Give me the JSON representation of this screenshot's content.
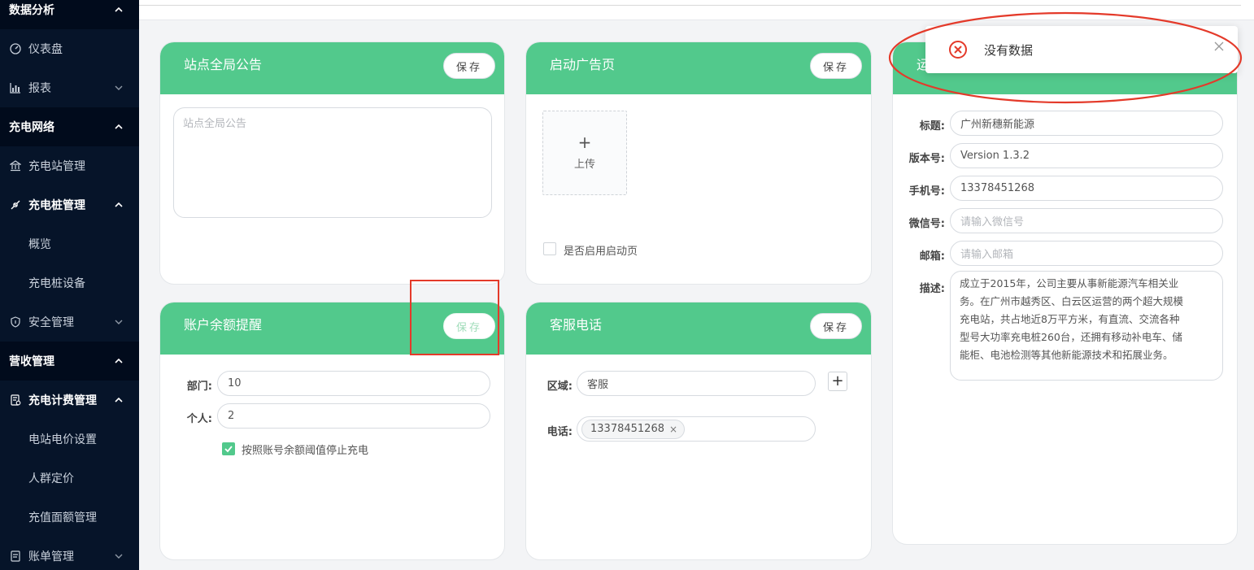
{
  "sidebar": {
    "items": [
      {
        "label": "数据分析",
        "kind": "group",
        "caret": "up"
      },
      {
        "label": "仪表盘",
        "kind": "item",
        "icon": "dashboard-icon"
      },
      {
        "label": "报表",
        "kind": "item",
        "icon": "chart-icon",
        "caret": "down"
      },
      {
        "label": "充电网络",
        "kind": "group",
        "caret": "up"
      },
      {
        "label": "充电站管理",
        "kind": "item",
        "icon": "bank-icon"
      },
      {
        "label": "充电桩管理",
        "kind": "item",
        "icon": "plug-icon",
        "caret": "up",
        "expanded": true
      },
      {
        "label": "概览",
        "kind": "sub"
      },
      {
        "label": "充电桩设备",
        "kind": "sub"
      },
      {
        "label": "安全管理",
        "kind": "item",
        "icon": "shield-icon",
        "caret": "down"
      },
      {
        "label": "营收管理",
        "kind": "group",
        "caret": "up"
      },
      {
        "label": "充电计费管理",
        "kind": "item",
        "icon": "billing-icon",
        "caret": "up",
        "expanded": true
      },
      {
        "label": "电站电价设置",
        "kind": "sub"
      },
      {
        "label": "人群定价",
        "kind": "sub"
      },
      {
        "label": "充值面额管理",
        "kind": "sub"
      },
      {
        "label": "账单管理",
        "kind": "item",
        "icon": "bill-icon",
        "caret": "down"
      }
    ]
  },
  "cards": {
    "announcement": {
      "title": "站点全局公告",
      "save_label": "保存",
      "textarea_placeholder": "站点全局公告"
    },
    "ad_page": {
      "title": "启动广告页",
      "save_label": "保存",
      "upload_plus": "+",
      "upload_label": "上传",
      "enable_label": "是否启用启动页",
      "enabled": false
    },
    "operator": {
      "title_partial": "运",
      "fields": [
        {
          "label": "标题:",
          "value": "广州新穗新能源",
          "placeholder": ""
        },
        {
          "label": "版本号:",
          "value": "Version 1.3.2",
          "placeholder": ""
        },
        {
          "label": "手机号:",
          "value": "13378451268",
          "placeholder": ""
        },
        {
          "label": "微信号:",
          "value": "",
          "placeholder": "请输入微信号"
        },
        {
          "label": "邮箱:",
          "value": "",
          "placeholder": "请输入邮箱"
        }
      ],
      "desc_label": "描述:",
      "desc_lines": [
        "成立于2015年，公司主要从事新能源汽车相关业",
        "务。在广州市越秀区、白云区运营的两个超大规模",
        "充电站，共占地近8万平方米，有直流、交流各种",
        "型号大功率充电桩260台，还拥有移动补电车、储",
        "能柜、电池检测等其他新能源技术和拓展业务。"
      ]
    },
    "balance": {
      "title": "账户余额提醒",
      "save_label": "保存",
      "dept_label": "部门:",
      "dept_value": "10",
      "personal_label": "个人:",
      "personal_value": "2",
      "stop_label": "按照账号余额阈值停止充电",
      "stop_checked": true
    },
    "service": {
      "title": "客服电话",
      "save_label": "保存",
      "area_label": "区域:",
      "area_value": "客服",
      "add_label": "+",
      "phone_label": "电话:",
      "phone_tag": "13378451268",
      "tag_close": "×"
    }
  },
  "toast": {
    "message": "没有数据",
    "type": "error",
    "close": "×"
  },
  "colors": {
    "accent": "#52c98c",
    "sidebar_bg": "#061429",
    "error": "#e43a2a"
  }
}
